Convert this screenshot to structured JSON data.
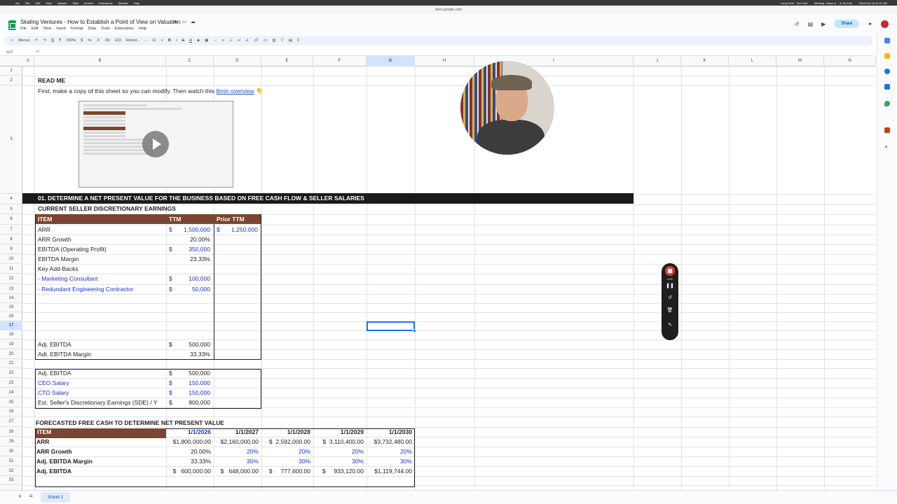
{
  "mac": {
    "menus": [
      "Arc",
      "File",
      "Edit",
      "View",
      "Spaces",
      "Tabs",
      "Archive",
      "Extensions",
      "Window",
      "Help"
    ],
    "status": [
      "Long Form · 28 m left",
      "Meeting: Jason & ... in 2h 13m",
      "Wed Dec 18 10:47 AM"
    ]
  },
  "browser": {
    "url": "docs.google.com"
  },
  "header": {
    "title": "Skaling Ventures - How to Establish a Point of View on Valuation",
    "menu": [
      "File",
      "Edit",
      "View",
      "Insert",
      "Format",
      "Data",
      "Tools",
      "Extensions",
      "Help"
    ],
    "share_label": "Share",
    "icons": [
      "star-icon",
      "move-icon",
      "cloud-icon"
    ]
  },
  "toolbar": {
    "menus_label": "Menus",
    "zoom": "150%",
    "currency": "$",
    "percent": "%",
    "dec_less": ".0",
    "dec_more": ".00",
    "format_num": "123",
    "font": "Helvet...",
    "font_size": "11",
    "bold": "B",
    "italic": "I",
    "strike": "S",
    "text_color": "A"
  },
  "formula": {
    "cell_ref": "G17",
    "fx": "fx"
  },
  "columns": [
    "A",
    "B",
    "C",
    "D",
    "E",
    "F",
    "G",
    "H",
    "I",
    "J",
    "K",
    "L",
    "M",
    "N"
  ],
  "selected_column": "G",
  "rows": [
    "1",
    "2",
    "3",
    "4",
    "5",
    "6",
    "7",
    "8",
    "9",
    "10",
    "11",
    "12",
    "13",
    "14",
    "15",
    "16",
    "17",
    "18",
    "19",
    "20",
    "21",
    "22",
    "23",
    "24",
    "25",
    "26",
    "27",
    "28",
    "29",
    "30",
    "31",
    "32",
    "33"
  ],
  "content": {
    "readme": "READ ME",
    "intro_text": "First, make a copy of this sheet so you can modify. Then watch this",
    "intro_link": "8min overview",
    "intro_emoji": "👇",
    "section1": "01. DETERMINE A NET PRESENT VALUE FOR THE BUSINESS BASED ON FREE CASH FLOW & SELLER SALARIES",
    "sde_title": "CURRENT SELLER DISCRETIONARY EARNINGS",
    "table1_headers": [
      "ITEM",
      "TTM",
      "Prior TTM"
    ],
    "table1": [
      {
        "item": "ARR",
        "sym": "$",
        "ttm": "1,500,000",
        "psym": "$",
        "prior": "1,250,000",
        "blue": true
      },
      {
        "item": "ARR Growth",
        "sym": "",
        "ttm": "20.00%",
        "psym": "",
        "prior": "",
        "blue": false
      },
      {
        "item": "EBITDA (Operating Profit)",
        "sym": "$",
        "ttm": "350,000",
        "psym": "",
        "prior": "",
        "blue": true
      },
      {
        "item": "EBITDA Margin",
        "sym": "",
        "ttm": "23.33%",
        "psym": "",
        "prior": "",
        "blue": false
      },
      {
        "item": "Key Add-Backs",
        "sym": "",
        "ttm": "",
        "psym": "",
        "prior": "",
        "blue": false
      },
      {
        "item": " - Marketing Consultant",
        "sym": "$",
        "ttm": "100,000",
        "psym": "",
        "prior": "",
        "blue": true
      },
      {
        "item": " - Redundant Engineering Contractor",
        "sym": "$",
        "ttm": "50,000",
        "psym": "",
        "prior": "",
        "blue": true
      }
    ],
    "adj": [
      {
        "item": "Adj. EBITDA",
        "sym": "$",
        "val": "500,000"
      },
      {
        "item": "Adt. EBITDA Margin",
        "sym": "",
        "val": "33.33%"
      }
    ],
    "table2": [
      {
        "item": "Adj. EBITDA",
        "sym": "$",
        "val": "500,000",
        "blue": false
      },
      {
        "item": "CEO Salary",
        "sym": "$",
        "val": "150,000",
        "blue": true
      },
      {
        "item": "CTO Salary",
        "sym": "$",
        "val": "150,000",
        "blue": true
      },
      {
        "item": "Est. Seller's Discretionary Earnings (SDE) / Y",
        "sym": "$",
        "val": "800,000",
        "blue": false
      }
    ],
    "forecast_title": "FORECASTED FREE CASH TO DETERMINE NET PRESENT VALUE",
    "forecast_headers": [
      "ITEM",
      "1/1/2026",
      "1/1/2027",
      "1/1/2028",
      "1/1/2029",
      "1/1/2030"
    ],
    "forecast": [
      {
        "item": "ARR",
        "cells": [
          "$1,800,000.00",
          "$2,160,000.00",
          "$  2,592,000.00",
          "$  3,110,400.00",
          "$3,732,480.00"
        ]
      },
      {
        "item": "ARR Growth",
        "cells": [
          "20.00%",
          "20%",
          "20%",
          "20%",
          "20%"
        ]
      },
      {
        "item": "Adj. EBITDA Margin",
        "cells": [
          "33.33%",
          "30%",
          "30%",
          "30%",
          "30%"
        ]
      },
      {
        "item": "Adj. EBITDA",
        "cells": [
          "$   600,000.00",
          "$   648,000.00",
          "$     777,600.00",
          "$     933,120.00",
          "$1,119,744.00"
        ]
      }
    ]
  },
  "recorder": {
    "time": "0:00"
  },
  "sheet_tab": "Sheet 1"
}
